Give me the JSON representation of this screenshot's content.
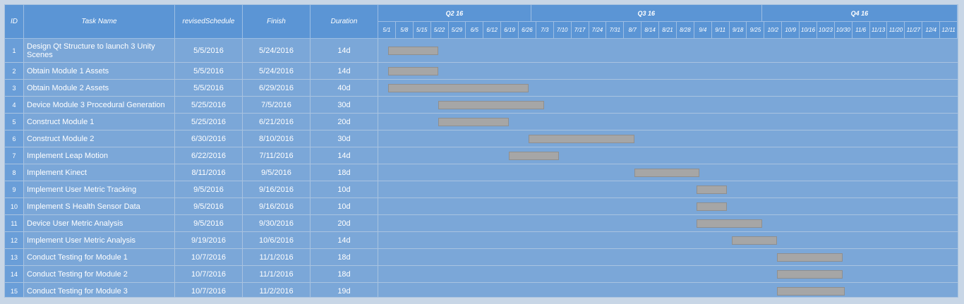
{
  "columns": {
    "id": "ID",
    "name": "Task Name",
    "start": "revisedSchedule",
    "finish": "Finish",
    "duration": "Duration"
  },
  "quarters": [
    "Q2 16",
    "Q3 16",
    "Q4 16"
  ],
  "weeks": [
    "5/1",
    "5/8",
    "5/15",
    "5/22",
    "5/29",
    "6/5",
    "6/12",
    "6/19",
    "6/26",
    "7/3",
    "7/10",
    "7/17",
    "7/24",
    "7/31",
    "8/7",
    "8/14",
    "8/21",
    "8/28",
    "9/4",
    "9/11",
    "9/18",
    "9/25",
    "10/2",
    "10/9",
    "10/16",
    "10/23",
    "10/30",
    "11/6",
    "11/13",
    "11/20",
    "11/27",
    "12/4",
    "12/11"
  ],
  "colors": {
    "table_bg": "#7ba7d8",
    "header_bg": "#5b95d5",
    "bar_fill": "#a6a6a6"
  },
  "chart_data": {
    "type": "bar",
    "subtype": "gantt",
    "x_axis": "time",
    "timeline_start": "2016-05-01",
    "grid": true,
    "tasks": [
      {
        "id": "1",
        "name": "Design Qt Structure to launch 3 Unity Scenes",
        "start": "5/5/2016",
        "finish": "5/24/2016",
        "duration": "14d"
      },
      {
        "id": "2",
        "name": "Obtain Module 1 Assets",
        "start": "5/5/2016",
        "finish": "5/24/2016",
        "duration": "14d"
      },
      {
        "id": "3",
        "name": "Obtain Module 2 Assets",
        "start": "5/5/2016",
        "finish": "6/29/2016",
        "duration": "40d"
      },
      {
        "id": "4",
        "name": "Device Module 3 Procedural Generation",
        "start": "5/25/2016",
        "finish": "7/5/2016",
        "duration": "30d"
      },
      {
        "id": "5",
        "name": "Construct Module 1",
        "start": "5/25/2016",
        "finish": "6/21/2016",
        "duration": "20d"
      },
      {
        "id": "6",
        "name": "Construct Module 2",
        "start": "6/30/2016",
        "finish": "8/10/2016",
        "duration": "30d"
      },
      {
        "id": "7",
        "name": "Implement Leap Motion",
        "start": "6/22/2016",
        "finish": "7/11/2016",
        "duration": "14d"
      },
      {
        "id": "8",
        "name": "Implement Kinect",
        "start": "8/11/2016",
        "finish": "9/5/2016",
        "duration": "18d"
      },
      {
        "id": "9",
        "name": "Implement User Metric Tracking",
        "start": "9/5/2016",
        "finish": "9/16/2016",
        "duration": "10d"
      },
      {
        "id": "10",
        "name": "Implement S Health Sensor Data",
        "start": "9/5/2016",
        "finish": "9/16/2016",
        "duration": "10d"
      },
      {
        "id": "11",
        "name": "Device User Metric Analysis",
        "start": "9/5/2016",
        "finish": "9/30/2016",
        "duration": "20d"
      },
      {
        "id": "12",
        "name": "Implement User Metric Analysis",
        "start": "9/19/2016",
        "finish": "10/6/2016",
        "duration": "14d"
      },
      {
        "id": "13",
        "name": "Conduct Testing for Module 1",
        "start": "10/7/2016",
        "finish": "11/1/2016",
        "duration": "18d"
      },
      {
        "id": "14",
        "name": "Conduct Testing for Module 2",
        "start": "10/7/2016",
        "finish": "11/1/2016",
        "duration": "18d"
      },
      {
        "id": "15",
        "name": "Conduct Testing for Module 3",
        "start": "10/7/2016",
        "finish": "11/2/2016",
        "duration": "19d"
      }
    ]
  }
}
